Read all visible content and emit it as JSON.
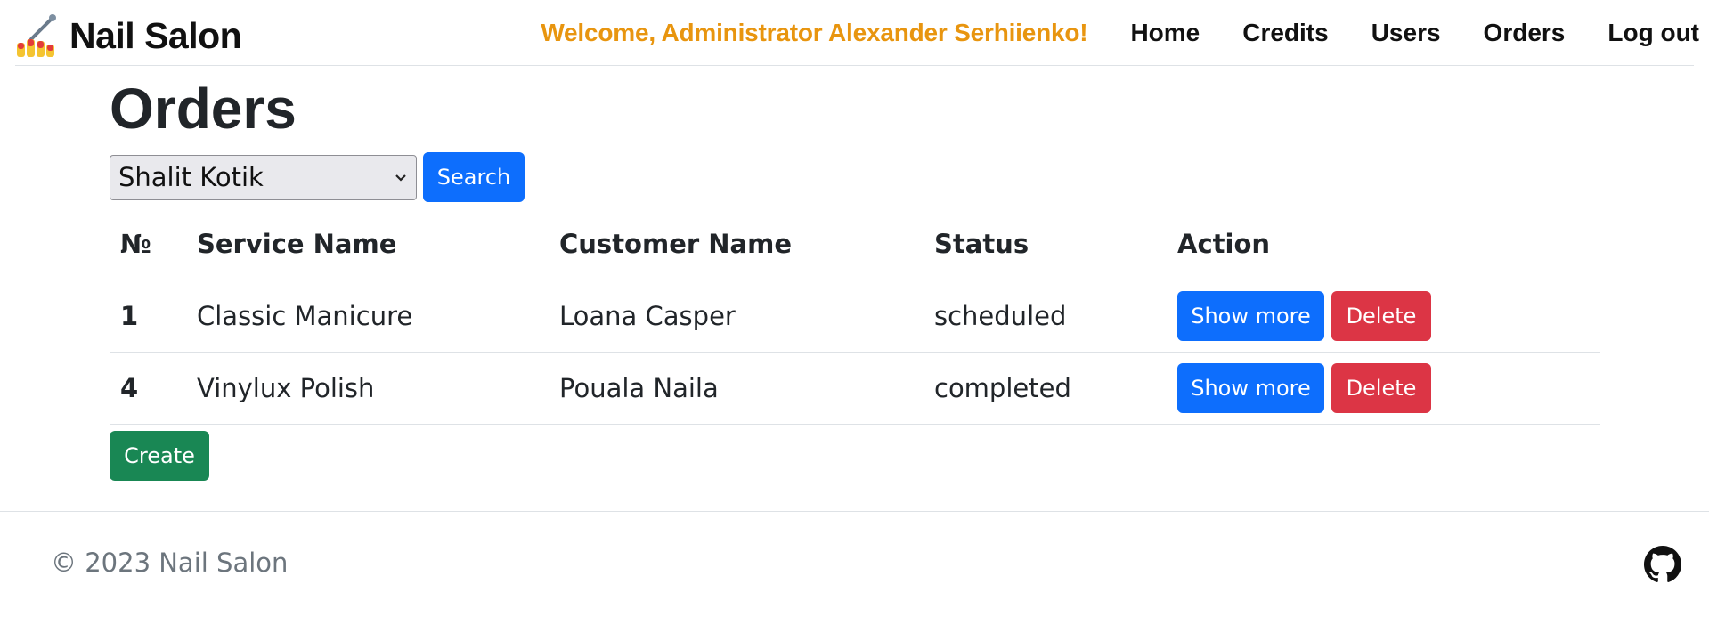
{
  "navbar": {
    "brand": "Nail Salon",
    "logo_icon": "nail-polish-icon",
    "welcome": "Welcome, Administrator Alexander Serhiienko!",
    "links": [
      "Home",
      "Credits",
      "Users",
      "Orders",
      "Log out"
    ]
  },
  "page": {
    "title": "Orders",
    "search_select_value": "Shalit Kotik",
    "search_button": "Search",
    "create_button": "Create"
  },
  "table": {
    "headers": [
      "№",
      "Service Name",
      "Customer Name",
      "Status",
      "Action"
    ],
    "rows": [
      {
        "num": "1",
        "service": "Classic Manicure",
        "customer": "Loana Casper",
        "status": "scheduled",
        "show": "Show more",
        "delete": "Delete"
      },
      {
        "num": "4",
        "service": "Vinylux Polish",
        "customer": "Pouala Naila",
        "status": "completed",
        "show": "Show more",
        "delete": "Delete"
      }
    ]
  },
  "footer": {
    "copyright": "© 2023 Nail Salon",
    "github_icon": "github-icon"
  },
  "colors": {
    "accent": "#e8950f",
    "primary": "#0d6efd",
    "danger": "#dc3545",
    "success": "#198754"
  }
}
